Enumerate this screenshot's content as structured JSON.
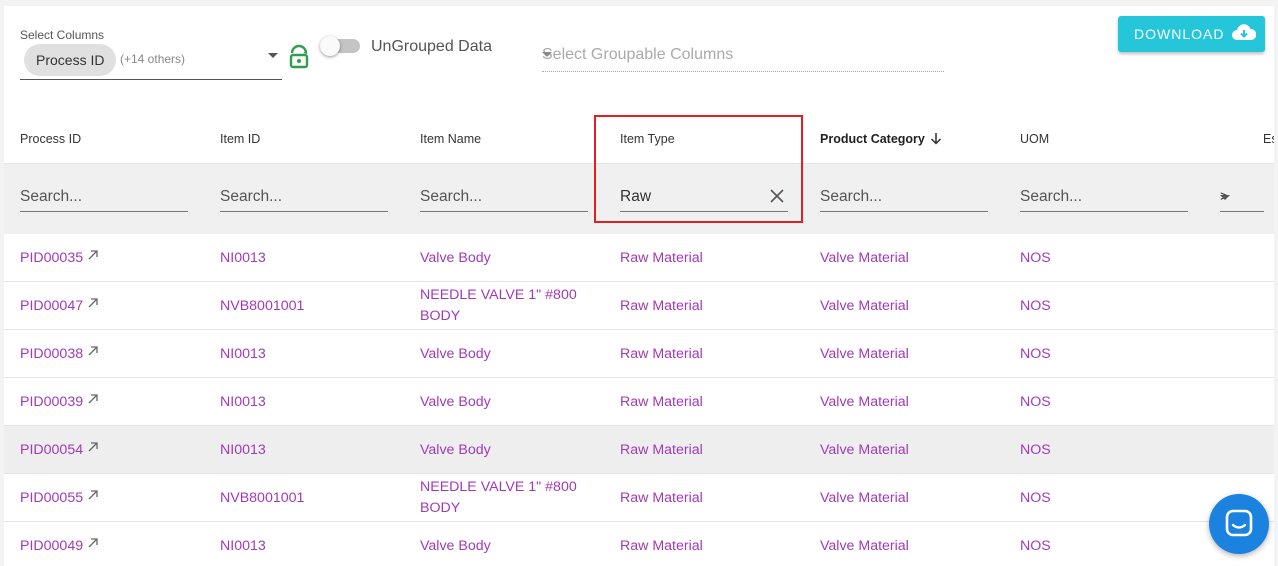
{
  "toolbar": {
    "select_columns_label": "Select Columns",
    "selected_chip": "Process ID",
    "others": "(+14 others)",
    "toggle_label": "UnGrouped Data",
    "groupable_placeholder": "Select Groupable Columns",
    "download_label": "DOWNLOAD"
  },
  "table": {
    "headers": [
      "Process ID",
      "Item ID",
      "Item Name",
      "Item Type",
      "Product Category",
      "UOM",
      "Es"
    ],
    "filters": {
      "placeholder": "Search...",
      "item_type_value": "Raw",
      "operator": ">"
    },
    "rows": [
      {
        "process_id": "PID00035",
        "item_id": "NI0013",
        "item_name": "Valve Body",
        "item_type": "Raw Material",
        "category": "Valve Material",
        "uom": "NOS"
      },
      {
        "process_id": "PID00047",
        "item_id": "NVB8001001",
        "item_name": "NEEDLE VALVE 1\" #800 BODY",
        "item_type": "Raw Material",
        "category": "Valve Material",
        "uom": "NOS"
      },
      {
        "process_id": "PID00038",
        "item_id": "NI0013",
        "item_name": "Valve Body",
        "item_type": "Raw Material",
        "category": "Valve Material",
        "uom": "NOS"
      },
      {
        "process_id": "PID00039",
        "item_id": "NI0013",
        "item_name": "Valve Body",
        "item_type": "Raw Material",
        "category": "Valve Material",
        "uom": "NOS"
      },
      {
        "process_id": "PID00054",
        "item_id": "NI0013",
        "item_name": "Valve Body",
        "item_type": "Raw Material",
        "category": "Valve Material",
        "uom": "NOS"
      },
      {
        "process_id": "PID00055",
        "item_id": "NVB8001001",
        "item_name": "NEEDLE VALVE 1\" #800 BODY",
        "item_type": "Raw Material",
        "category": "Valve Material",
        "uom": "NOS"
      },
      {
        "process_id": "PID00049",
        "item_id": "NI0013",
        "item_name": "Valve Body",
        "item_type": "Raw Material",
        "category": "Valve Material",
        "uom": "NOS"
      }
    ]
  },
  "colors": {
    "link": "#a03ab8",
    "accent": "#26c6da",
    "lock": "#2e9e4f",
    "highlight": "#e02020",
    "chat": "#1b82e0"
  }
}
